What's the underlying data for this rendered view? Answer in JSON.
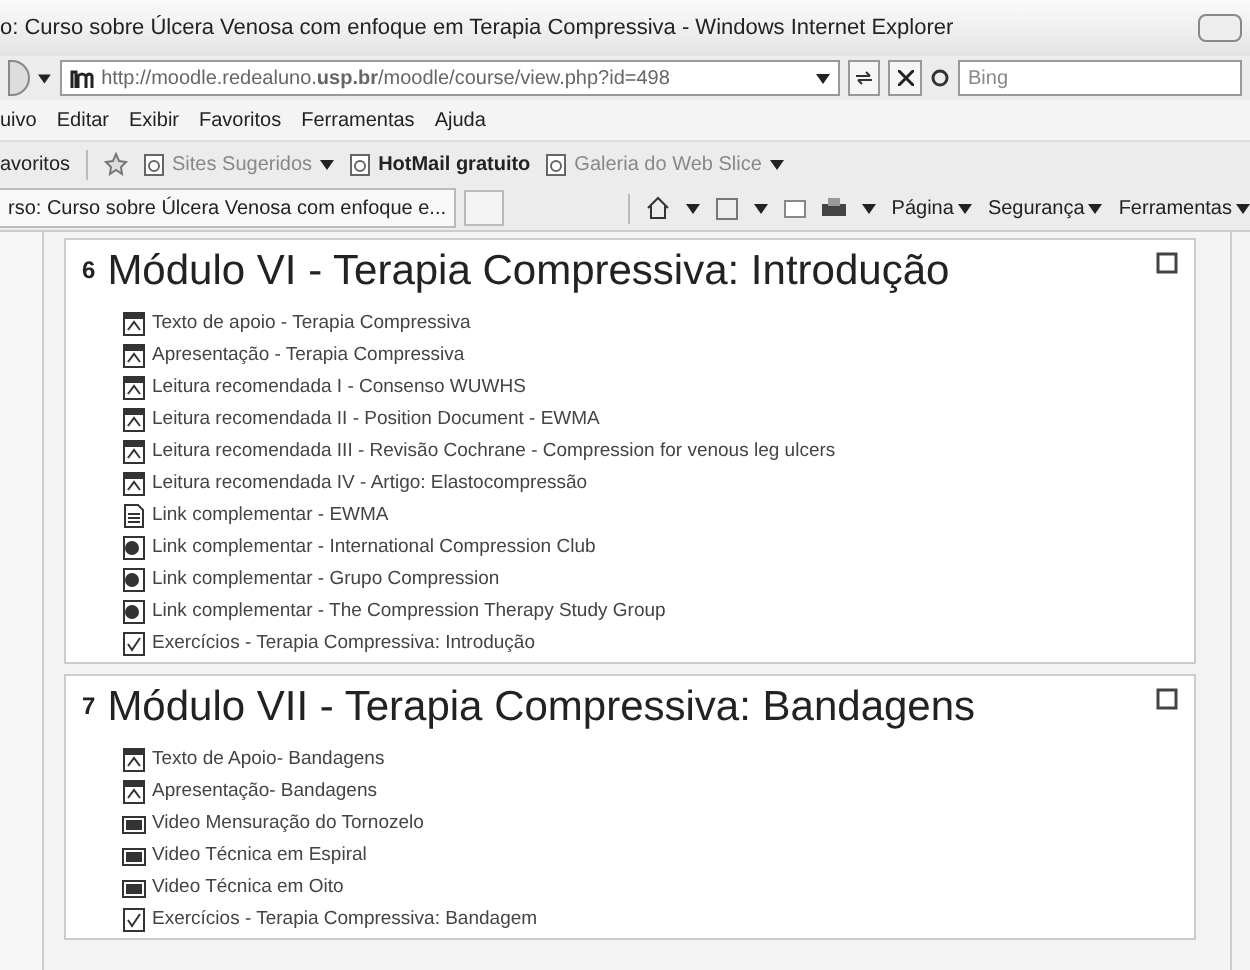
{
  "window": {
    "title": "o: Curso sobre Úlcera Venosa com enfoque em Terapia Compressiva - Windows Internet Explorer"
  },
  "address_bar": {
    "url": "http://moodle.redealuno.**usp.br**/moodle/course/view.php?id=498",
    "search_placeholder": "Bing"
  },
  "menu": [
    "uivo",
    "Editar",
    "Exibir",
    "Favoritos",
    "Ferramentas",
    "Ajuda"
  ],
  "favorites_bar": {
    "label": "avoritos",
    "links": [
      {
        "label": "Sites Sugeridos",
        "dropdown": true,
        "bold": false
      },
      {
        "label": "HotMail gratuito",
        "dropdown": false,
        "bold": true
      },
      {
        "label": "Galeria do Web Slice",
        "dropdown": true,
        "bold": false
      }
    ]
  },
  "tab": {
    "title": "rso: Curso sobre Úlcera Venosa com enfoque e..."
  },
  "command_bar": [
    "Página",
    "Segurança",
    "Ferramentas"
  ],
  "sections": [
    {
      "number": "6",
      "title": "Módulo VI - Terapia Compressiva: Introdução",
      "items": [
        {
          "kind": "pdf",
          "label": "Texto de apoio - Terapia Compressiva"
        },
        {
          "kind": "pdf",
          "label": "Apresentação - Terapia Compressiva"
        },
        {
          "kind": "pdf",
          "label": "Leitura recomendada I - Consenso WUWHS"
        },
        {
          "kind": "pdf",
          "label": "Leitura recomendada II - Position Document - EWMA"
        },
        {
          "kind": "pdf",
          "label": "Leitura recomendada III - Revisão Cochrane - Compression for venous leg ulcers"
        },
        {
          "kind": "pdf",
          "label": "Leitura recomendada IV - Artigo: Elastocompressão"
        },
        {
          "kind": "page",
          "label": "Link complementar - EWMA"
        },
        {
          "kind": "web",
          "label": "Link complementar - International Compression Club"
        },
        {
          "kind": "web",
          "label": "Link complementar - Grupo Compression"
        },
        {
          "kind": "web",
          "label": "Link complementar - The Compression Therapy Study Group"
        },
        {
          "kind": "quiz",
          "label": "Exercícios - Terapia Compressiva: Introdução"
        }
      ]
    },
    {
      "number": "7",
      "title": "Módulo VII - Terapia Compressiva: Bandagens",
      "items": [
        {
          "kind": "pdf",
          "label": "Texto de Apoio- Bandagens"
        },
        {
          "kind": "pdf",
          "label": "Apresentação- Bandagens"
        },
        {
          "kind": "video",
          "label": "Video Mensuração do Tornozelo"
        },
        {
          "kind": "video",
          "label": "Video Técnica em Espiral"
        },
        {
          "kind": "video",
          "label": "Video Técnica em Oito"
        },
        {
          "kind": "quiz",
          "label": "Exercícios - Terapia Compressiva: Bandagem"
        }
      ]
    }
  ]
}
